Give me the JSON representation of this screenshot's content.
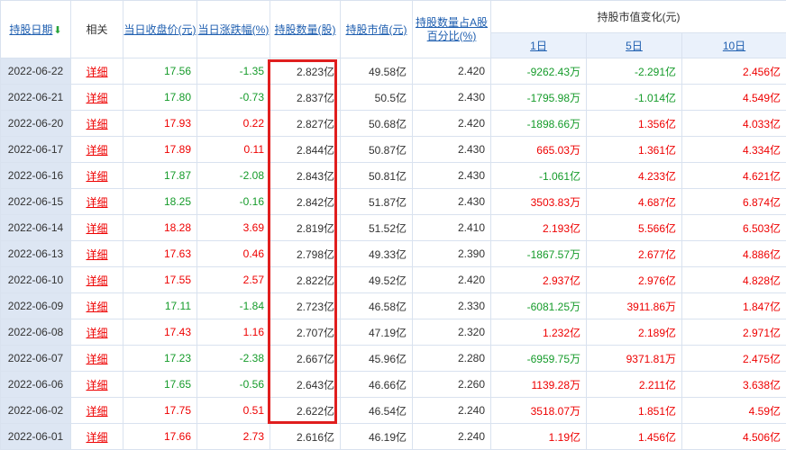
{
  "headers": {
    "date": "持股日期",
    "related": "相关",
    "close": "当日收盘价(元)",
    "change": "当日涨跌幅(%)",
    "qty": "持股数量(股)",
    "mktval": "持股市值(元)",
    "pct_line1": "持股数量占A股",
    "pct_line2": "百分比(%)",
    "chg_group": "持股市值变化(元)",
    "d1": "1日",
    "d5": "5日",
    "d10": "10日"
  },
  "colors": {
    "up": "#e00000",
    "down": "#159b2a",
    "highlight_box": "#e01e1e"
  },
  "rows": [
    {
      "date": "2022-06-22",
      "link": "详细",
      "close": "17.56",
      "change": "-1.35",
      "qty": "2.823亿",
      "mktval": "49.58亿",
      "pct": "2.420",
      "d1": "-9262.43万",
      "d5": "-2.291亿",
      "d10": "2.456亿"
    },
    {
      "date": "2022-06-21",
      "link": "详细",
      "close": "17.80",
      "change": "-0.73",
      "qty": "2.837亿",
      "mktval": "50.5亿",
      "pct": "2.430",
      "d1": "-1795.98万",
      "d5": "-1.014亿",
      "d10": "4.549亿"
    },
    {
      "date": "2022-06-20",
      "link": "详细",
      "close": "17.93",
      "change": "0.22",
      "qty": "2.827亿",
      "mktval": "50.68亿",
      "pct": "2.420",
      "d1": "-1898.66万",
      "d5": "1.356亿",
      "d10": "4.033亿"
    },
    {
      "date": "2022-06-17",
      "link": "详细",
      "close": "17.89",
      "change": "0.11",
      "qty": "2.844亿",
      "mktval": "50.87亿",
      "pct": "2.430",
      "d1": "665.03万",
      "d5": "1.361亿",
      "d10": "4.334亿"
    },
    {
      "date": "2022-06-16",
      "link": "详细",
      "close": "17.87",
      "change": "-2.08",
      "qty": "2.843亿",
      "mktval": "50.81亿",
      "pct": "2.430",
      "d1": "-1.061亿",
      "d5": "4.233亿",
      "d10": "4.621亿"
    },
    {
      "date": "2022-06-15",
      "link": "详细",
      "close": "18.25",
      "change": "-0.16",
      "qty": "2.842亿",
      "mktval": "51.87亿",
      "pct": "2.430",
      "d1": "3503.83万",
      "d5": "4.687亿",
      "d10": "6.874亿"
    },
    {
      "date": "2022-06-14",
      "link": "详细",
      "close": "18.28",
      "change": "3.69",
      "qty": "2.819亿",
      "mktval": "51.52亿",
      "pct": "2.410",
      "d1": "2.193亿",
      "d5": "5.566亿",
      "d10": "6.503亿"
    },
    {
      "date": "2022-06-13",
      "link": "详细",
      "close": "17.63",
      "change": "0.46",
      "qty": "2.798亿",
      "mktval": "49.33亿",
      "pct": "2.390",
      "d1": "-1867.57万",
      "d5": "2.677亿",
      "d10": "4.886亿"
    },
    {
      "date": "2022-06-10",
      "link": "详细",
      "close": "17.55",
      "change": "2.57",
      "qty": "2.822亿",
      "mktval": "49.52亿",
      "pct": "2.420",
      "d1": "2.937亿",
      "d5": "2.976亿",
      "d10": "4.828亿"
    },
    {
      "date": "2022-06-09",
      "link": "详细",
      "close": "17.11",
      "change": "-1.84",
      "qty": "2.723亿",
      "mktval": "46.58亿",
      "pct": "2.330",
      "d1": "-6081.25万",
      "d5": "3911.86万",
      "d10": "1.847亿"
    },
    {
      "date": "2022-06-08",
      "link": "详细",
      "close": "17.43",
      "change": "1.16",
      "qty": "2.707亿",
      "mktval": "47.19亿",
      "pct": "2.320",
      "d1": "1.232亿",
      "d5": "2.189亿",
      "d10": "2.971亿"
    },
    {
      "date": "2022-06-07",
      "link": "详细",
      "close": "17.23",
      "change": "-2.38",
      "qty": "2.667亿",
      "mktval": "45.96亿",
      "pct": "2.280",
      "d1": "-6959.75万",
      "d5": "9371.81万",
      "d10": "2.475亿"
    },
    {
      "date": "2022-06-06",
      "link": "详细",
      "close": "17.65",
      "change": "-0.56",
      "qty": "2.643亿",
      "mktval": "46.66亿",
      "pct": "2.260",
      "d1": "1139.28万",
      "d5": "2.211亿",
      "d10": "3.638亿"
    },
    {
      "date": "2022-06-02",
      "link": "详细",
      "close": "17.75",
      "change": "0.51",
      "qty": "2.622亿",
      "mktval": "46.54亿",
      "pct": "2.240",
      "d1": "3518.07万",
      "d5": "1.851亿",
      "d10": "4.59亿"
    },
    {
      "date": "2022-06-01",
      "link": "详细",
      "close": "17.66",
      "change": "2.73",
      "qty": "2.616亿",
      "mktval": "46.19亿",
      "pct": "2.240",
      "d1": "1.19亿",
      "d5": "1.456亿",
      "d10": "4.506亿"
    }
  ]
}
